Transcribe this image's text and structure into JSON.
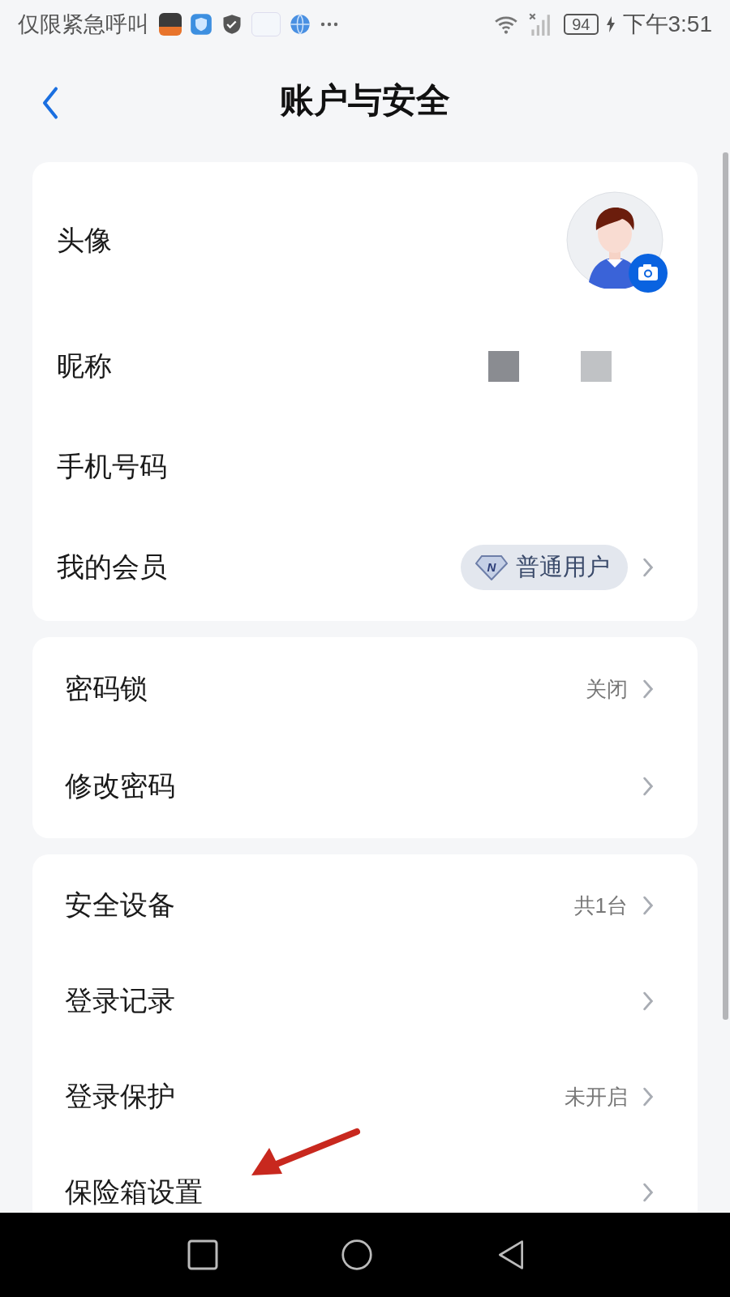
{
  "status_bar": {
    "carrier": "仅限紧急呼叫",
    "battery": "94",
    "time": "下午3:51"
  },
  "header": {
    "title": "账户与安全"
  },
  "sections": [
    {
      "rows": [
        {
          "kind": "avatar",
          "label": "头像",
          "chevron": false
        },
        {
          "kind": "redacted",
          "label": "昵称",
          "chevron": false
        },
        {
          "kind": "plain",
          "label": "手机号码",
          "chevron": false
        },
        {
          "kind": "badge",
          "label": "我的会员",
          "badge": "普通用户",
          "badge_letter": "N",
          "chevron": true
        }
      ]
    },
    {
      "rows": [
        {
          "kind": "value",
          "label": "密码锁",
          "value": "关闭",
          "chevron": true
        },
        {
          "kind": "plain",
          "label": "修改密码",
          "chevron": true
        }
      ]
    },
    {
      "rows": [
        {
          "kind": "value",
          "label": "安全设备",
          "value": "共1台",
          "chevron": true
        },
        {
          "kind": "plain",
          "label": "登录记录",
          "chevron": true
        },
        {
          "kind": "value",
          "label": "登录保护",
          "value": "未开启",
          "chevron": true
        },
        {
          "kind": "plain",
          "label": "保险箱设置",
          "chevron": true
        }
      ]
    }
  ]
}
